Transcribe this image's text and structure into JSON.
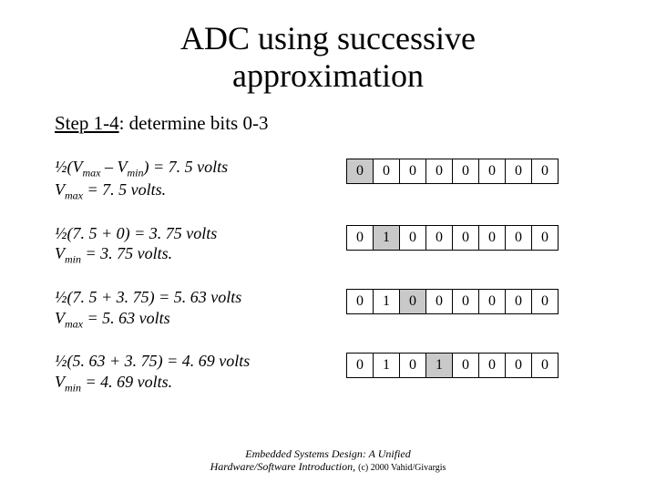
{
  "title_line1": "ADC using successive",
  "title_line2": "approximation",
  "step_prefix": "Step 1-4",
  "step_rest": ": determine bits 0-3",
  "rows": [
    {
      "eq1_pre": "½(V",
      "eq1_sub1": "max",
      "eq1_mid": " – V",
      "eq1_sub2": "min",
      "eq1_post": ") = 7. 5 volts",
      "eq2_pre": "V",
      "eq2_sub": "max",
      "eq2_post": " = 7. 5 volts.",
      "bits": [
        "0",
        "0",
        "0",
        "0",
        "0",
        "0",
        "0",
        "0"
      ],
      "hl": [
        0
      ]
    },
    {
      "eq1_plain": "½(7. 5 + 0) = 3. 75 volts",
      "eq2_pre": "V",
      "eq2_sub": "min",
      "eq2_post": " = 3. 75 volts.",
      "bits": [
        "0",
        "1",
        "0",
        "0",
        "0",
        "0",
        "0",
        "0"
      ],
      "hl": [
        1
      ]
    },
    {
      "eq1_plain": "½(7. 5 + 3. 75) = 5. 63 volts",
      "eq2_pre": "V",
      "eq2_sub": "max",
      "eq2_post": " = 5. 63 volts",
      "bits": [
        "0",
        "1",
        "0",
        "0",
        "0",
        "0",
        "0",
        "0"
      ],
      "hl": [
        2
      ]
    },
    {
      "eq1_plain": "½(5. 63 + 3. 75) = 4. 69 volts",
      "eq2_pre": "V",
      "eq2_sub": "min",
      "eq2_post": " = 4. 69 volts.",
      "bits": [
        "0",
        "1",
        "0",
        "1",
        "0",
        "0",
        "0",
        "0"
      ],
      "hl": [
        3
      ]
    }
  ],
  "footer_line1": "Embedded Systems Design: A Unified",
  "footer_line2_a": "Hardware/Software Introduction, ",
  "footer_line2_b": "(c) 2000 Vahid/Givargis"
}
